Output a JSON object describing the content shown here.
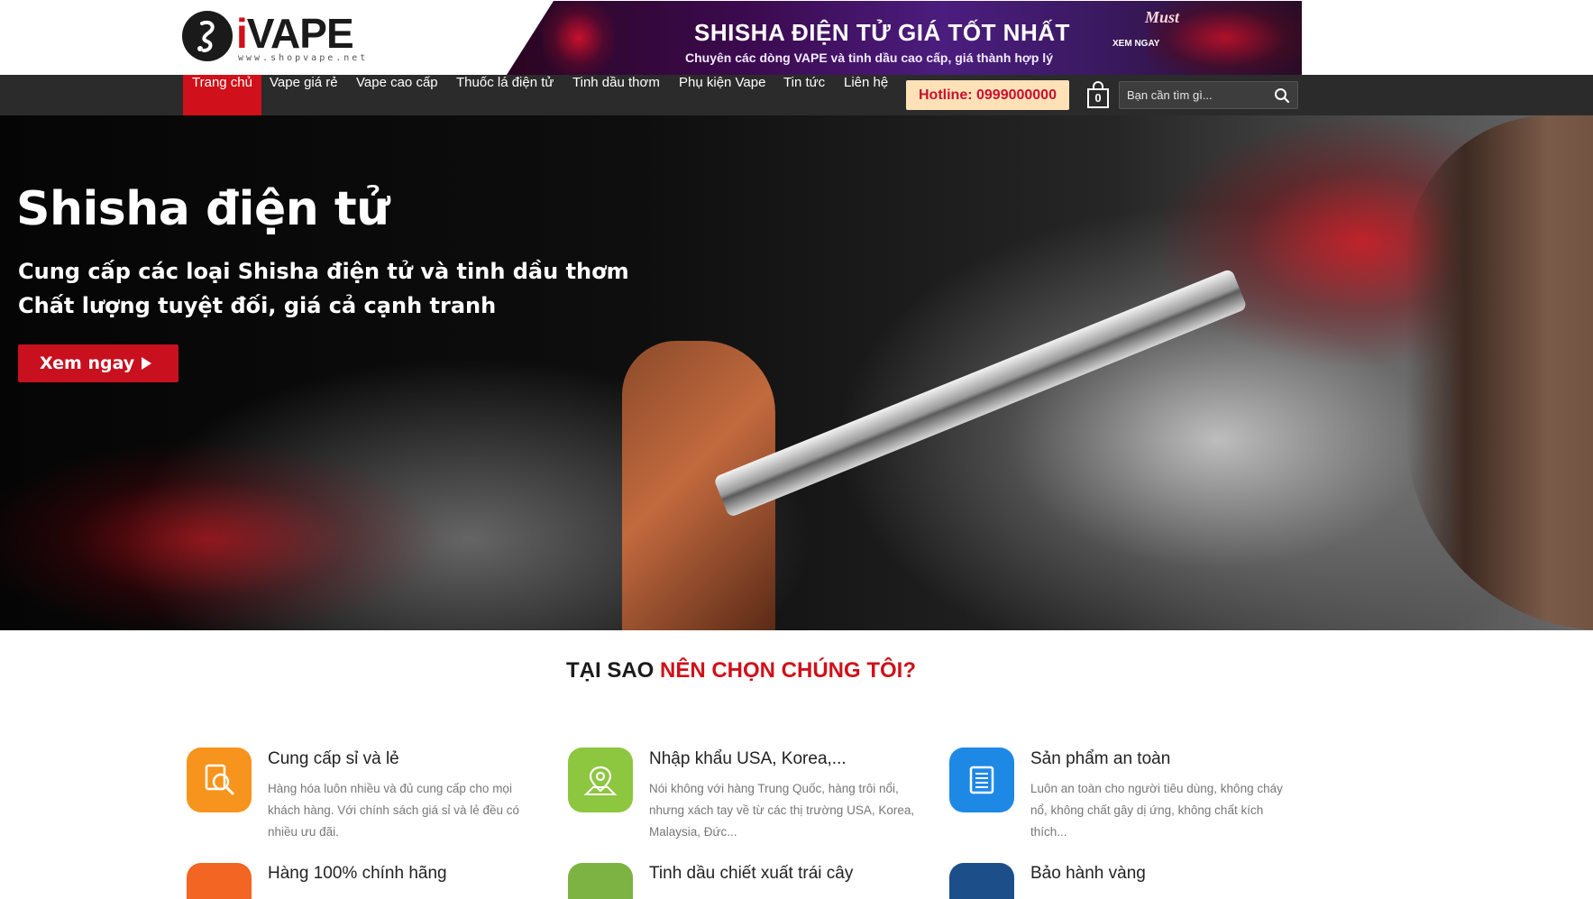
{
  "header": {
    "logo_text_i": "i",
    "logo_text_vape": "VAPE",
    "logo_sub": "www.shopvape.net",
    "banner_title": "SHISHA ĐIỆN TỬ GIÁ TỐT NHẤT",
    "banner_subtitle": "Chuyên các dòng VAPE và tinh dầu cao cấp, giá thành hợp lý",
    "banner_cta": "XEM NGAY",
    "banner_brand": "Must"
  },
  "nav": {
    "items": [
      {
        "label": "Trang chủ",
        "active": true
      },
      {
        "label": "Vape giá rẻ"
      },
      {
        "label": "Vape cao cấp"
      },
      {
        "label": "Thuốc lá điện tử"
      },
      {
        "label": "Tinh dầu thơm"
      },
      {
        "label": "Phụ kiện Vape"
      },
      {
        "label": "Tin tức"
      },
      {
        "label": "Liên hệ"
      }
    ],
    "hotline": "Hotline: 0999000000",
    "cart_count": "0",
    "search_placeholder": "Bạn cần tìm gì..."
  },
  "hero": {
    "title": "Shisha điện tử",
    "line1": "Cung cấp các loại Shisha điện tử và tinh dầu thơm",
    "line2": "Chất lượng tuyệt đối, giá cả cạnh tranh",
    "button": "Xem ngay"
  },
  "section": {
    "title_prefix": "TẠI SAO ",
    "title_accent": "NÊN CHỌN CHÚNG TÔI?"
  },
  "features": [
    {
      "title": "Cung cấp sỉ và lẻ",
      "desc": "Hàng hóa luôn nhiều và đủ cung cấp cho mọi khách hàng. Với chính sách giá sỉ và lẻ đều có nhiều ưu đãi.",
      "color": "#f7941d",
      "icon": "search-document-icon"
    },
    {
      "title": "Nhập khẩu USA, Korea,...",
      "desc": "Nói không với hàng Trung Quốc, hàng trôi nổi, nhưng xách tay về từ các thị trường USA, Korea, Malaysia, Đức...",
      "color": "#8dc63f",
      "icon": "map-pin-icon"
    },
    {
      "title": "Sản phẩm an toàn",
      "desc": "Luôn an toàn cho người tiêu dùng, không cháy nổ, không chất gây dị ứng, không chất kích thích...",
      "color": "#1e88e5",
      "icon": "document-list-icon"
    },
    {
      "title": "Hàng 100% chính hãng",
      "color": "#f26522"
    },
    {
      "title": "Tinh dầu chiết xuất trái cây",
      "color": "#7cb342"
    },
    {
      "title": "Bảo hành vàng",
      "color": "#1c4f8a"
    }
  ]
}
